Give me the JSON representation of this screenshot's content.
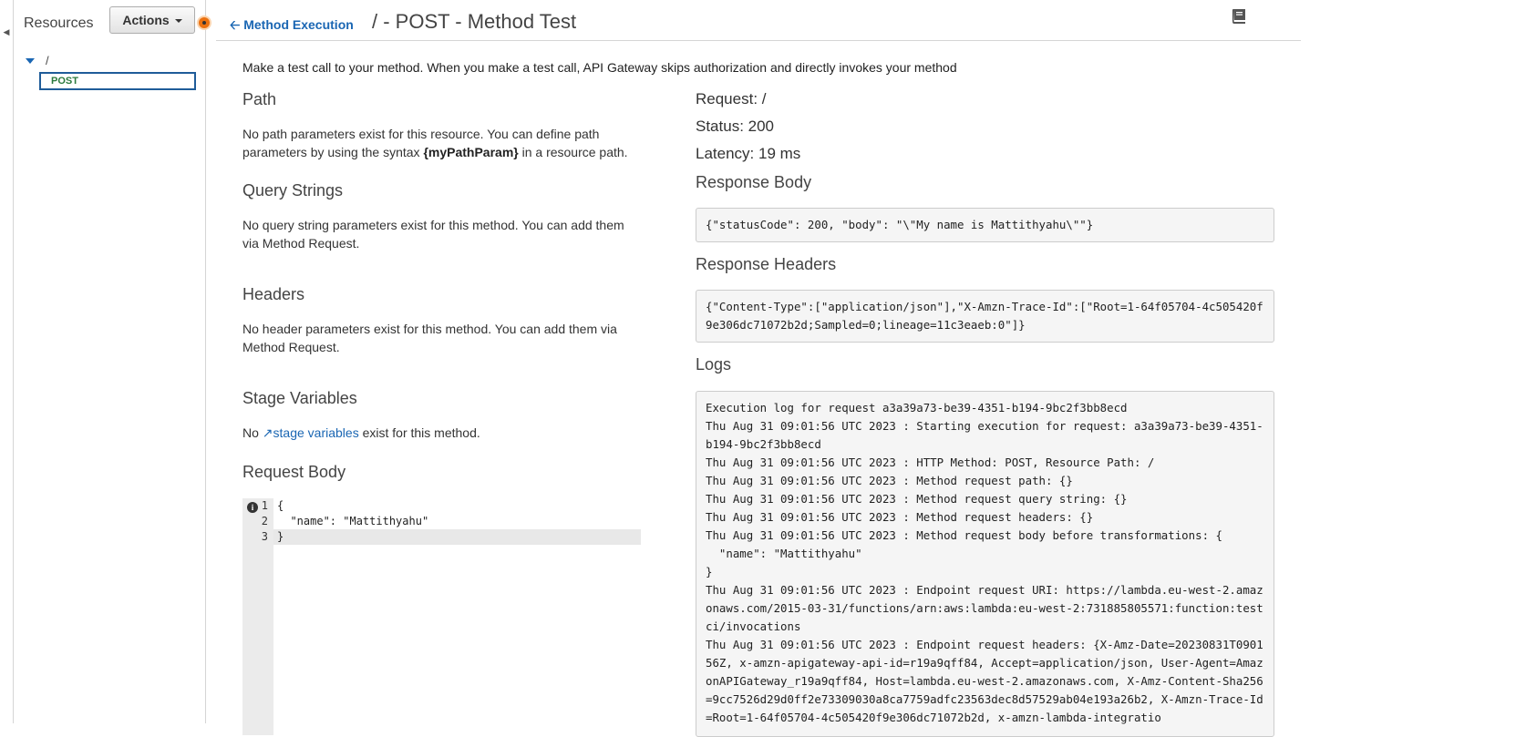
{
  "sidebar": {
    "resources_label": "Resources",
    "actions_label": "Actions",
    "tree": {
      "root": "/",
      "method": "POST"
    }
  },
  "header": {
    "back_label": "Method Execution",
    "title": "/ - POST - Method Test"
  },
  "intro": "Make a test call to your method. When you make a test call, API Gateway skips authorization and directly invokes your method",
  "left": {
    "path": {
      "title": "Path",
      "text_before": "No path parameters exist for this resource. You can define path parameters by using the syntax ",
      "text_bold": "{myPathParam}",
      "text_after": " in a resource path."
    },
    "query": {
      "title": "Query Strings",
      "text": "No query string parameters exist for this method. You can add them via Method Request."
    },
    "headers": {
      "title": "Headers",
      "text": "No header parameters exist for this method. You can add them via Method Request."
    },
    "stage": {
      "title": "Stage Variables",
      "text_before": "No ",
      "link": "stage variables",
      "text_after": " exist for this method."
    },
    "request_body": {
      "title": "Request Body",
      "lines": [
        "{",
        "  \"name\": \"Mattithyahu\"",
        "}"
      ],
      "line_numbers": [
        "1",
        "2",
        "3"
      ]
    }
  },
  "right": {
    "request": "Request: /",
    "status": "Status: 200",
    "latency": "Latency: 19 ms",
    "response_body_title": "Response Body",
    "response_body": "{\"statusCode\": 200, \"body\": \"\\\"My name is Mattithyahu\\\"\"}",
    "response_headers_title": "Response Headers",
    "response_headers": "{\"Content-Type\":[\"application/json\"],\"X-Amzn-Trace-Id\":[\"Root=1-64f05704-4c505420f9e306dc71072b2d;Sampled=0;lineage=11c3eaeb:0\"]}",
    "logs_title": "Logs",
    "logs": "Execution log for request a3a39a73-be39-4351-b194-9bc2f3bb8ecd\nThu Aug 31 09:01:56 UTC 2023 : Starting execution for request: a3a39a73-be39-4351-b194-9bc2f3bb8ecd\nThu Aug 31 09:01:56 UTC 2023 : HTTP Method: POST, Resource Path: /\nThu Aug 31 09:01:56 UTC 2023 : Method request path: {}\nThu Aug 31 09:01:56 UTC 2023 : Method request query string: {}\nThu Aug 31 09:01:56 UTC 2023 : Method request headers: {}\nThu Aug 31 09:01:56 UTC 2023 : Method request body before transformations: {\n  \"name\": \"Mattithyahu\"\n}\nThu Aug 31 09:01:56 UTC 2023 : Endpoint request URI: https://lambda.eu-west-2.amazonaws.com/2015-03-31/functions/arn:aws:lambda:eu-west-2:731885805571:function:testci/invocations\nThu Aug 31 09:01:56 UTC 2023 : Endpoint request headers: {X-Amz-Date=20230831T090156Z, x-amzn-apigateway-api-id=r19a9qff84, Accept=application/json, User-Agent=AmazonAPIGateway_r19a9qff84, Host=lambda.eu-west-2.amazonaws.com, X-Amz-Content-Sha256=9cc7526d29d0ff2e73309030a8ca7759adfc23563dec8d57529ab04e193a26b2, X-Amzn-Trace-Id=Root=1-64f05704-4c505420f9e306dc71072b2d, x-amzn-lambda-integratio"
  }
}
